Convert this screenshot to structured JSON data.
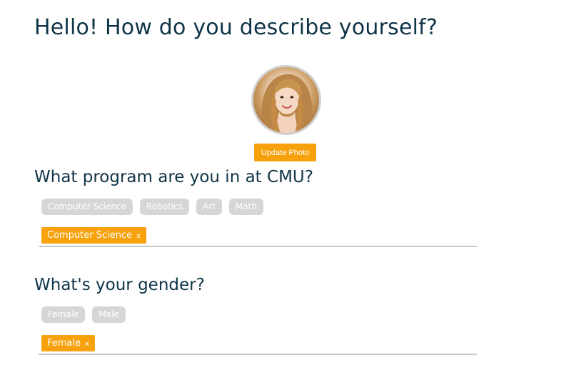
{
  "page": {
    "title": "Hello! How do you describe yourself?"
  },
  "profile": {
    "avatar_icon": "profile-photo",
    "update_photo_label": "Update Photo"
  },
  "program": {
    "question": "What program are you in at CMU?",
    "options": [
      "Computer Science",
      "Robotics",
      "Art",
      "Math"
    ],
    "selected": [
      "Computer Science"
    ],
    "remove_label": "x"
  },
  "gender": {
    "question": "What's your gender?",
    "options": [
      "Female",
      "Male"
    ],
    "selected": [
      "Female"
    ],
    "remove_label": "x"
  },
  "colors": {
    "accent": "#f7a10d",
    "heading": "#0f3447",
    "chip_inactive": "#d6d6d6"
  }
}
